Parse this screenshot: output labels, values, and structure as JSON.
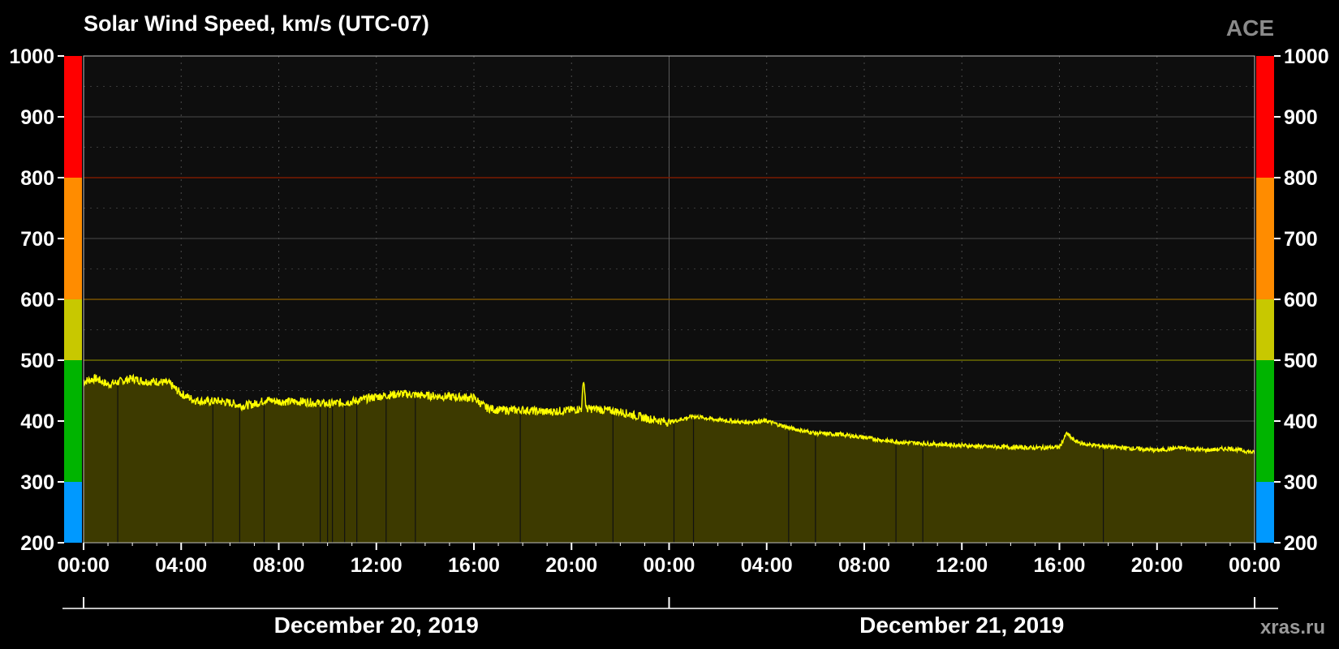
{
  "title": "Solar Wind Speed, km/s (UTC-07)",
  "source_label": "ACE",
  "site_label": "xras.ru",
  "chart_data": {
    "type": "area",
    "title": "Solar Wind Speed, km/s (UTC-07)",
    "xlabel": "",
    "ylabel": "",
    "ylim": [
      200,
      1000
    ],
    "xlim_hours": [
      0,
      48
    ],
    "y_ticks": [
      200,
      300,
      400,
      500,
      600,
      700,
      800,
      900,
      1000
    ],
    "x_tick_hours": [
      0,
      4,
      8,
      12,
      16,
      20,
      24,
      28,
      32,
      36,
      40,
      44,
      48
    ],
    "x_tick_labels": [
      "00:00",
      "04:00",
      "08:00",
      "12:00",
      "16:00",
      "20:00",
      "00:00",
      "04:00",
      "08:00",
      "12:00",
      "16:00",
      "20:00",
      "00:00"
    ],
    "date_labels": [
      "December 20, 2019",
      "December 21, 2019"
    ],
    "grid": true,
    "color_bands": [
      {
        "from": 200,
        "to": 300,
        "color": "#0099ff"
      },
      {
        "from": 300,
        "to": 500,
        "color": "#00b400"
      },
      {
        "from": 500,
        "to": 600,
        "color": "#c8c800"
      },
      {
        "from": 600,
        "to": 800,
        "color": "#ff8c00"
      },
      {
        "from": 800,
        "to": 1000,
        "color": "#ff0000"
      }
    ],
    "threshold_lines": [
      {
        "value": 500,
        "color": "#6b6b00"
      },
      {
        "value": 600,
        "color": "#7a5200"
      },
      {
        "value": 800,
        "color": "#7a1a00"
      }
    ],
    "series": [
      {
        "line_color": "#ffff00",
        "fill_color": "#3d3a00",
        "x_hours": [
          0,
          0.5,
          1,
          1.5,
          2,
          2.5,
          3,
          3.5,
          4,
          4.5,
          5,
          5.5,
          6,
          6.5,
          7,
          7.5,
          8,
          9,
          10,
          11,
          12,
          13,
          14,
          15,
          16,
          16.5,
          17,
          18,
          19,
          20,
          20.4,
          20.5,
          20.6,
          21,
          22,
          23,
          24,
          25,
          26,
          27,
          28,
          29,
          30,
          31,
          32,
          33,
          34,
          35,
          36,
          37,
          38,
          39,
          40,
          40.3,
          40.6,
          41,
          42,
          43,
          44,
          45,
          46,
          47,
          48
        ],
        "values": [
          465,
          470,
          460,
          465,
          470,
          465,
          465,
          462,
          445,
          435,
          432,
          433,
          430,
          425,
          428,
          435,
          432,
          432,
          428,
          432,
          440,
          445,
          442,
          440,
          438,
          422,
          418,
          418,
          415,
          418,
          420,
          470,
          420,
          420,
          415,
          405,
          398,
          408,
          402,
          398,
          400,
          388,
          380,
          378,
          373,
          367,
          364,
          362,
          360,
          358,
          357,
          356,
          357,
          380,
          368,
          362,
          358,
          355,
          352,
          356,
          352,
          355,
          348
        ]
      }
    ],
    "data_gaps_hours": [
      1.4,
      5.3,
      6.4,
      7.4,
      9.7,
      10,
      10.2,
      10.7,
      11.2,
      12.4,
      13.6,
      17.9,
      21.7,
      24.2,
      25,
      28.9,
      30,
      33.3,
      34.4,
      41.8
    ]
  }
}
